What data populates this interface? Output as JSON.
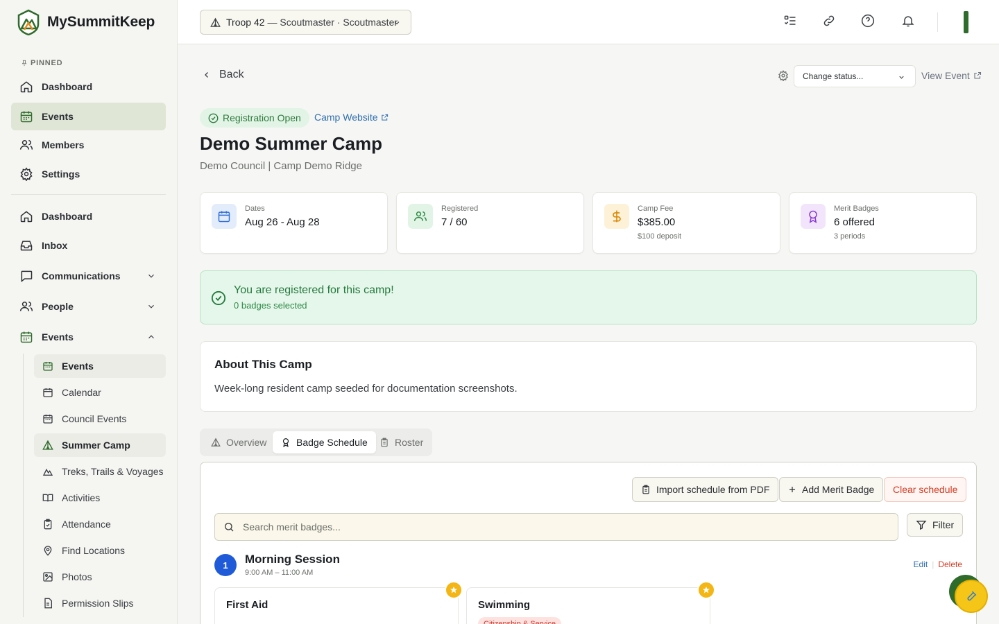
{
  "app": {
    "name": "MySummitKeep"
  },
  "sidebar": {
    "pinned_label": "PINNED",
    "pinned": [
      {
        "label": "Dashboard",
        "icon": "home-icon"
      },
      {
        "label": "Events",
        "icon": "calendar-icon",
        "active": true
      },
      {
        "label": "Members",
        "icon": "users-icon"
      },
      {
        "label": "Settings",
        "icon": "gear-icon"
      }
    ],
    "main": [
      {
        "label": "Dashboard",
        "icon": "home-icon"
      },
      {
        "label": "Inbox",
        "icon": "inbox-icon"
      },
      {
        "label": "Communications",
        "icon": "chat-icon",
        "expanded": false
      },
      {
        "label": "People",
        "icon": "users-icon",
        "expanded": false
      },
      {
        "label": "Events",
        "icon": "calendar-icon",
        "expanded": true
      }
    ],
    "events_sub": [
      {
        "label": "Events",
        "icon": "calendar-icon",
        "bold": true
      },
      {
        "label": "Calendar",
        "icon": "calendar-icon"
      },
      {
        "label": "Council Events",
        "icon": "calendar-icon"
      },
      {
        "label": "Summer Camp",
        "icon": "tent-icon",
        "bold": true
      },
      {
        "label": "Treks, Trails & Voyages",
        "icon": "mountain-icon"
      },
      {
        "label": "Activities",
        "icon": "book-icon"
      },
      {
        "label": "Attendance",
        "icon": "clipboard-check-icon"
      },
      {
        "label": "Find Locations",
        "icon": "map-pin-icon"
      },
      {
        "label": "Photos",
        "icon": "image-icon"
      },
      {
        "label": "Permission Slips",
        "icon": "file-icon"
      }
    ]
  },
  "topbar": {
    "troop_selector": "Troop 42",
    "troop_role": "— Scoutmaster · Scoutmaster"
  },
  "event": {
    "back_label": "Back",
    "status_placeholder": "Change status...",
    "view_event_label": "View Event",
    "registration_badge": "Registration Open",
    "camp_website_label": "Camp Website",
    "title": "Demo Summer Camp",
    "subtitle": "Demo Council | Camp Demo Ridge",
    "stats": [
      {
        "label": "Dates",
        "value": "Aug 26 - Aug 28",
        "extra": ""
      },
      {
        "label": "Registered",
        "value": "7 / 60",
        "extra": ""
      },
      {
        "label": "Camp Fee",
        "value": "$385.00",
        "extra": "$100 deposit"
      },
      {
        "label": "Merit Badges",
        "value": "6 offered",
        "extra": "3 periods"
      }
    ],
    "registration_notice": {
      "title": "You are registered for this camp!",
      "subtitle": "0 badges selected"
    },
    "about": {
      "title": "About This Camp",
      "body": "Week-long resident camp seeded for documentation screenshots."
    },
    "tabs": [
      {
        "label": "Overview",
        "icon": "tent-icon"
      },
      {
        "label": "Badge Schedule",
        "icon": "award-icon",
        "active": true
      },
      {
        "label": "Roster",
        "icon": "clipboard-icon"
      }
    ]
  },
  "schedule": {
    "import_label": "Import schedule from PDF",
    "add_label": "Add Merit Badge",
    "clear_label": "Clear schedule",
    "search_placeholder": "Search merit badges...",
    "filter_label": "Filter",
    "session": {
      "number": "1",
      "title": "Morning Session",
      "time": "9:00 AM – 11:00 AM",
      "edit_label": "Edit",
      "delete_label": "Delete"
    },
    "badges": [
      {
        "name": "First Aid",
        "tag": ""
      },
      {
        "name": "Swimming",
        "tag": "Citizenship & Service"
      }
    ]
  },
  "colors": {
    "accent_green": "#2f6b2b",
    "active_nav_bg": "#dfe6d6",
    "success_green": "#247a3c",
    "danger_red": "#d23a22",
    "session_blue": "#1f5bd8",
    "star_gold": "#f3b614"
  }
}
